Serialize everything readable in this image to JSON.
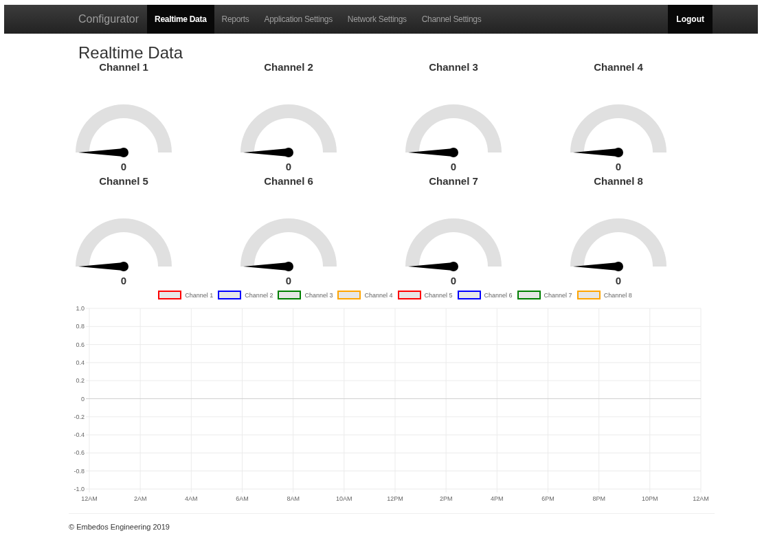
{
  "navbar": {
    "brand": "Configurator",
    "items": [
      {
        "label": "Realtime Data",
        "selected": true
      },
      {
        "label": "Reports",
        "selected": false
      },
      {
        "label": "Application Settings",
        "selected": false
      },
      {
        "label": "Network Settings",
        "selected": false
      },
      {
        "label": "Channel Settings",
        "selected": false
      }
    ],
    "logout": "Logout"
  },
  "page_title": "Realtime Data",
  "gauges": [
    {
      "title": "Channel 1",
      "reading": "0"
    },
    {
      "title": "Channel 2",
      "reading": "0"
    },
    {
      "title": "Channel 3",
      "reading": "0"
    },
    {
      "title": "Channel 4",
      "reading": "0"
    },
    {
      "title": "Channel 5",
      "reading": "0"
    },
    {
      "title": "Channel 6",
      "reading": "0"
    },
    {
      "title": "Channel 7",
      "reading": "0"
    },
    {
      "title": "Channel 8",
      "reading": "0"
    }
  ],
  "chart": {
    "chart_data": {
      "type": "line",
      "grid": true,
      "x": [
        "12AM",
        "2AM",
        "4AM",
        "6AM",
        "8AM",
        "10AM",
        "12PM",
        "2PM",
        "4PM",
        "6PM",
        "8PM",
        "10PM",
        "12AM"
      ],
      "ylim": [
        -1,
        1
      ],
      "yticks": [
        {
          "value": 1,
          "label": "1.0"
        },
        {
          "value": 0.8,
          "label": "0.8"
        },
        {
          "value": 0.6,
          "label": "0.6"
        },
        {
          "value": 0.4,
          "label": "0.4"
        },
        {
          "value": 0.2,
          "label": "0.2"
        },
        {
          "value": 0,
          "label": "0"
        },
        {
          "value": -0.2,
          "label": "-0.2"
        },
        {
          "value": -0.4,
          "label": "-0.4"
        },
        {
          "value": -0.6,
          "label": "-0.6"
        },
        {
          "value": -0.8,
          "label": "-0.8"
        },
        {
          "value": -1,
          "label": "-1.0"
        }
      ],
      "series": [
        {
          "name": "Channel 1",
          "color": "#ff0000",
          "values": [
            null,
            null,
            null,
            null,
            null,
            null,
            null,
            null,
            null,
            null,
            null,
            null,
            null
          ]
        },
        {
          "name": "Channel 2",
          "color": "#0000ff",
          "values": [
            null,
            null,
            null,
            null,
            null,
            null,
            null,
            null,
            null,
            null,
            null,
            null,
            null
          ]
        },
        {
          "name": "Channel 3",
          "color": "#008000",
          "values": [
            null,
            null,
            null,
            null,
            null,
            null,
            null,
            null,
            null,
            null,
            null,
            null,
            null
          ]
        },
        {
          "name": "Channel 4",
          "color": "#ffa500",
          "values": [
            null,
            null,
            null,
            null,
            null,
            null,
            null,
            null,
            null,
            null,
            null,
            null,
            null
          ]
        },
        {
          "name": "Channel 5",
          "color": "#ff0000",
          "values": [
            null,
            null,
            null,
            null,
            null,
            null,
            null,
            null,
            null,
            null,
            null,
            null,
            null
          ]
        },
        {
          "name": "Channel 6",
          "color": "#0000ff",
          "values": [
            null,
            null,
            null,
            null,
            null,
            null,
            null,
            null,
            null,
            null,
            null,
            null,
            null
          ]
        },
        {
          "name": "Channel 7",
          "color": "#008000",
          "values": [
            null,
            null,
            null,
            null,
            null,
            null,
            null,
            null,
            null,
            null,
            null,
            null,
            null
          ]
        },
        {
          "name": "Channel 8",
          "color": "#ffa500",
          "values": [
            null,
            null,
            null,
            null,
            null,
            null,
            null,
            null,
            null,
            null,
            null,
            null,
            null
          ]
        }
      ]
    }
  },
  "footer": "© Embedos Engineering 2019"
}
